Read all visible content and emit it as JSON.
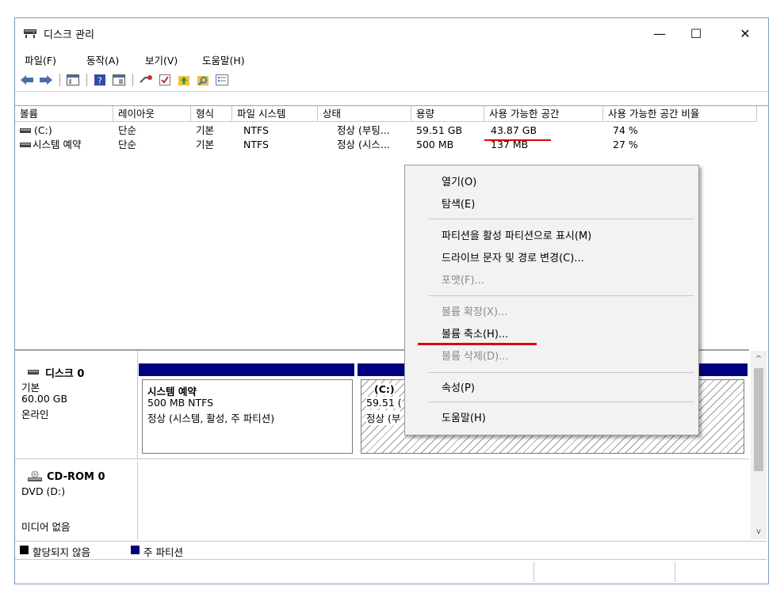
{
  "window": {
    "title": "디스크 관리",
    "controls": {
      "minimize": "—",
      "maximize": "☐",
      "close": "✕"
    }
  },
  "menu": [
    "파일(F)",
    "동작(A)",
    "보기(V)",
    "도움말(H)"
  ],
  "toolbar_icons": [
    "back-icon",
    "forward-icon",
    "console-tree-icon",
    "help-icon",
    "properties-icon",
    "connect-icon",
    "check-icon",
    "up-icon",
    "search-icon",
    "list-icon"
  ],
  "volume_table": {
    "headers": [
      "볼륨",
      "레이아웃",
      "형식",
      "파일 시스템",
      "상태",
      "용량",
      "사용 가능한 공간",
      "사용 가능한 공간 비율"
    ],
    "rows": [
      {
        "volume": "(C:)",
        "layout": "단순",
        "type": "기본",
        "fs": "NTFS",
        "status": "정상 (부팅...",
        "capacity": "59.51 GB",
        "free": "43.87 GB",
        "pct": "74 %"
      },
      {
        "volume": "시스템 예약",
        "layout": "단순",
        "type": "기본",
        "fs": "NTFS",
        "status": "정상 (시스...",
        "capacity": "500 MB",
        "free": "137 MB",
        "pct": "27 %"
      }
    ]
  },
  "context_menu": {
    "items": [
      {
        "label": "열기(O)",
        "enabled": true
      },
      {
        "label": "탐색(E)",
        "enabled": true
      },
      {
        "label": "파티션을 활성 파티션으로 표시(M)",
        "enabled": true
      },
      {
        "label": "드라이브 문자 및 경로 변경(C)...",
        "enabled": true
      },
      {
        "label": "포맷(F)...",
        "enabled": false
      },
      {
        "label": "볼륨 확장(X)...",
        "enabled": false
      },
      {
        "label": "볼륨 축소(H)...",
        "enabled": true
      },
      {
        "label": "볼륨 삭제(D)...",
        "enabled": false
      },
      {
        "label": "속성(P)",
        "enabled": true
      },
      {
        "label": "도움말(H)",
        "enabled": true
      }
    ]
  },
  "disks": {
    "disk0": {
      "name": "디스크 0",
      "kind": "기본",
      "size": "60.00 GB",
      "state": "온라인",
      "partitions": [
        {
          "name": "시스템 예약",
          "size": "500 MB NTFS",
          "status": "정상 (시스템, 활성, 주 파티션)"
        },
        {
          "name": "(C:)",
          "size": "59.51 (",
          "status": "정상 (부"
        }
      ]
    },
    "cdrom0": {
      "name": "CD-ROM 0",
      "drive": "DVD (D:)",
      "state": "미디어 없음"
    }
  },
  "legend": [
    {
      "label": "할당되지 않음",
      "color": "#000000"
    },
    {
      "label": "주 파티션",
      "color": "#000080"
    }
  ],
  "colors": {
    "partition_header": "#000080",
    "annotation_red": "#e00000",
    "selection_hatch": "#9a9a9a"
  }
}
